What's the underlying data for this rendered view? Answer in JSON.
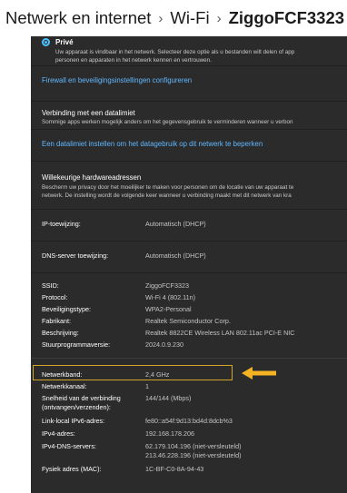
{
  "breadcrumb": {
    "parts": [
      "Netwerk en internet",
      "Wi-Fi",
      "ZiggoFCF3323"
    ],
    "separator": "›"
  },
  "privacy": {
    "option_label": "Privé",
    "option_desc_1": "Uw apparaat is vindbaar in het netwerk. Selecteer deze optie als u bestanden wilt delen of app",
    "option_desc_2": "personen en apparaten in het netwerk kennen en vertrouwen.",
    "firewall_link": "Firewall en beveiligingsinstellingen configureren"
  },
  "metered": {
    "title": "Verbinding met een datalimiet",
    "desc": "Sommige apps werken mogelijk anders om het gegevensgebruik te verminderen wanneer u verbon",
    "link": "Een datalimiet instellen om het datagebruik op dit netwerk te beperken"
  },
  "random_mac": {
    "title": "Willekeurige hardwareadressen",
    "desc_1": "Bescherm uw privacy door het moeilijker te maken voor personen om de locatie van uw apparaat te",
    "desc_2": "netwerk. De instelling wordt de volgende keer wanneer u verbinding maakt met dit netwerk van kra"
  },
  "ip_assignment": {
    "label": "IP-toewijzing:",
    "value": "Automatisch (DHCP)"
  },
  "dns_assignment": {
    "label": "DNS-server toewijzing:",
    "value": "Automatisch (DHCP)"
  },
  "properties": [
    {
      "label": "SSID:",
      "value": "ZiggoFCF3323"
    },
    {
      "label": "Protocol:",
      "value": "Wi-Fi 4 (802.11n)"
    },
    {
      "label": "Beveiligingstype:",
      "value": "WPA2-Personal"
    },
    {
      "label": "Fabrikant:",
      "value": "Realtek Semiconductor Corp."
    },
    {
      "label": "Beschrijving:",
      "value": "Realtek 8822CE Wireless LAN 802.11ac PCI-E NIC"
    },
    {
      "label": "Stuurprogrammaversie:",
      "value": "2024.0.9.230"
    }
  ],
  "properties2": [
    {
      "label": "Netwerkband:",
      "value": "2,4 GHz"
    },
    {
      "label": "Netwerkkanaal:",
      "value": "1"
    },
    {
      "label": "Snelheid van de verbinding",
      "label2": "(ontvangen/verzenden):",
      "value": "144/144 (Mbps)"
    },
    {
      "label": "Link-local IPv6-adres:",
      "value": "fe80::a54f:9d13:bd4d:8dcb%3"
    },
    {
      "label": "IPv4-adres:",
      "value": "192.168.178.206"
    },
    {
      "label": "IPv4-DNS-servers:",
      "value": "62.179.104.196 (niet-versleuteld)",
      "value2": "213.46.228.196 (niet-versleuteld)"
    },
    {
      "label": "Fysiek adres (MAC):",
      "value": "1C-BF-C0-8A-94-43"
    }
  ],
  "colors": {
    "highlight_border": "#d4a52a",
    "arrow": "#f5b324",
    "accent": "#4cc2ff",
    "link": "#60b8ff"
  }
}
